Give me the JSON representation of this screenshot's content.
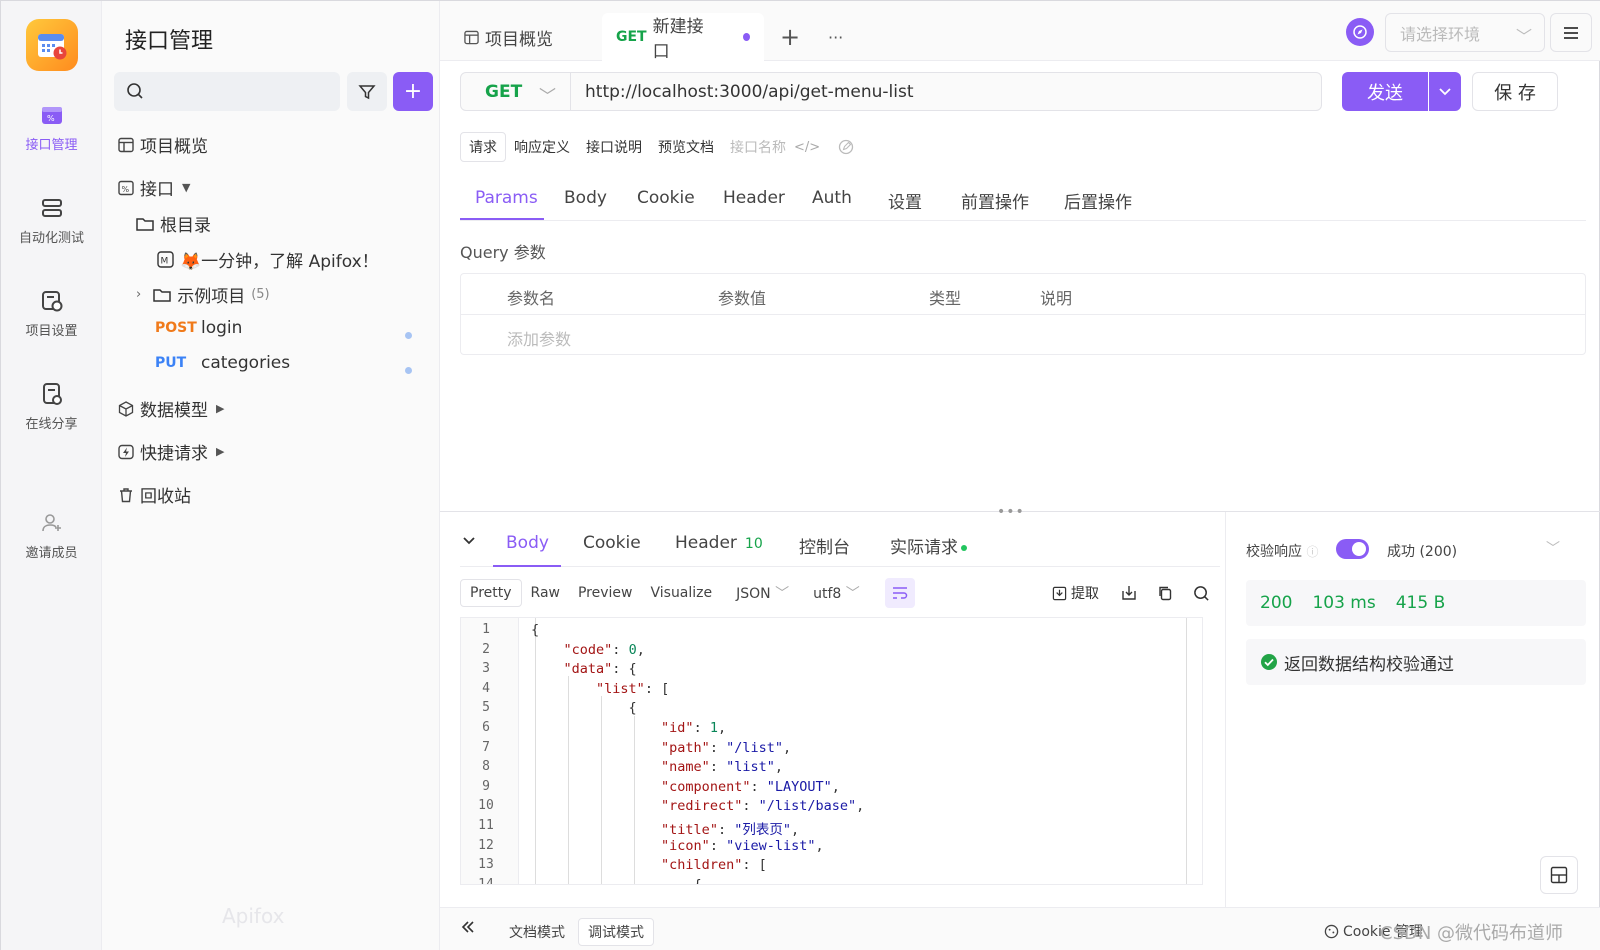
{
  "rail": {
    "items": [
      {
        "label": "接口管理",
        "icon": "api-manage-icon",
        "active": true
      },
      {
        "label": "自动化测试",
        "icon": "stack-icon"
      },
      {
        "label": "项目设置",
        "icon": "project-settings-icon"
      },
      {
        "label": "在线分享",
        "icon": "share-doc-icon"
      },
      {
        "label": "邀请成员",
        "icon": "add-user-icon"
      }
    ]
  },
  "tree": {
    "title": "接口管理",
    "search_placeholder": "",
    "items": {
      "overview": "项目概览",
      "api": "接口",
      "root": "根目录",
      "doc": "🦊一分钟，了解 Apifox！",
      "example": "示例项目",
      "example_count": "(5)",
      "login_method": "POST",
      "login_name": "login",
      "cat_method": "PUT",
      "cat_name": "categories",
      "models": "数据模型",
      "quick": "快捷请求",
      "trash": "回收站"
    },
    "watermark": "Apifox"
  },
  "tabs": {
    "overview": "项目概览",
    "new_method": "GET",
    "new_label": "新建接口",
    "plus": "+",
    "more": "···"
  },
  "env": {
    "placeholder": "请选择环境"
  },
  "request": {
    "method": "GET",
    "url": "http://localhost:3000/api/get-menu-list",
    "send": "发送",
    "save": "保 存",
    "subtabs": [
      "请求",
      "响应定义",
      "接口说明",
      "预览文档"
    ],
    "name_placeholder": "接口名称",
    "param_tabs": [
      "Params",
      "Body",
      "Cookie",
      "Header",
      "Auth",
      "设置",
      "前置操作",
      "后置操作"
    ],
    "query_label": "Query 参数",
    "query_headers": [
      "参数名",
      "参数值",
      "类型",
      "说明"
    ],
    "add_param": "添加参数"
  },
  "response": {
    "tabs": {
      "body": "Body",
      "cookie": "Cookie",
      "header": "Header",
      "header_count": "10",
      "console": "控制台",
      "actual": "实际请求"
    },
    "formats": [
      "Pretty",
      "Raw",
      "Preview",
      "Visualize"
    ],
    "type": "JSON",
    "encoding": "utf8",
    "extract": "提取",
    "lines": [
      "{",
      "    \"code\": 0,",
      "    \"data\": {",
      "        \"list\": [",
      "            {",
      "                \"id\": 1,",
      "                \"path\": \"/list\",",
      "                \"name\": \"list\",",
      "                \"component\": \"LAYOUT\",",
      "                \"redirect\": \"/list/base\",",
      "                \"title\": \"列表页\",",
      "                \"icon\": \"view-list\",",
      "                \"children\": [",
      "                    {"
    ],
    "line_numbers": [
      "1",
      "2",
      "3",
      "4",
      "5",
      "6",
      "7",
      "8",
      "9",
      "10",
      "11",
      "12",
      "13",
      "14"
    ]
  },
  "validation": {
    "label": "校验响应",
    "status": "成功 (200)",
    "code": "200",
    "time": "103 ms",
    "size": "415 B",
    "pass": "返回数据结构校验通过"
  },
  "bottom": {
    "doc_mode": "文档模式",
    "debug_mode": "调试模式",
    "cookie_mgmt": "Cookie 管理",
    "credit": "CSDN @微代码布道师"
  },
  "colors": {
    "accent": "#8a5cf5",
    "get": "#16a34a",
    "post": "#f07a1a",
    "put": "#3b82f6"
  }
}
